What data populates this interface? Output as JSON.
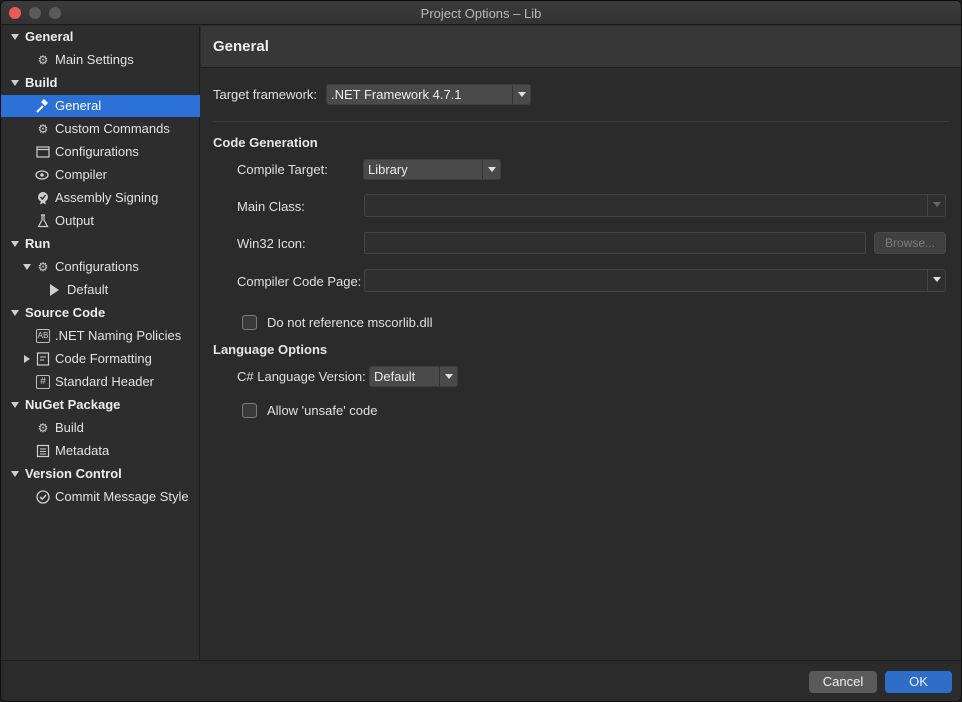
{
  "window": {
    "title": "Project Options – Lib"
  },
  "sidebar": {
    "items": [
      {
        "label": "General"
      },
      {
        "label": "Main Settings"
      },
      {
        "label": "Build"
      },
      {
        "label": "General"
      },
      {
        "label": "Custom Commands"
      },
      {
        "label": "Configurations"
      },
      {
        "label": "Compiler"
      },
      {
        "label": "Assembly Signing"
      },
      {
        "label": "Output"
      },
      {
        "label": "Run"
      },
      {
        "label": "Configurations"
      },
      {
        "label": "Default"
      },
      {
        "label": "Source Code"
      },
      {
        "label": ".NET Naming Policies"
      },
      {
        "label": "Code Formatting"
      },
      {
        "label": "Standard Header"
      },
      {
        "label": "NuGet Package"
      },
      {
        "label": "Build"
      },
      {
        "label": "Metadata"
      },
      {
        "label": "Version Control"
      },
      {
        "label": "Commit Message Style"
      }
    ]
  },
  "main": {
    "title": "General",
    "target_framework": {
      "label": "Target framework:",
      "value": ".NET Framework 4.7.1"
    },
    "code_generation": {
      "heading": "Code Generation",
      "compile_target": {
        "label": "Compile Target:",
        "value": "Library"
      },
      "main_class": {
        "label": "Main Class:",
        "value": ""
      },
      "win32_icon": {
        "label": "Win32 Icon:",
        "value": "",
        "browse_label": "Browse..."
      },
      "compiler_code_page": {
        "label": "Compiler Code Page:",
        "value": ""
      },
      "no_mscorlib": {
        "label": "Do not reference mscorlib.dll",
        "checked": false
      }
    },
    "language_options": {
      "heading": "Language Options",
      "language_version": {
        "label": "C# Language Version:",
        "value": "Default"
      },
      "allow_unsafe": {
        "label": "Allow 'unsafe' code",
        "checked": false
      }
    }
  },
  "footer": {
    "cancel_label": "Cancel",
    "ok_label": "OK"
  },
  "colors": {
    "accent": "#2a70d6",
    "ok_button": "#2e6ec9",
    "close_button": "#ed5a55"
  }
}
